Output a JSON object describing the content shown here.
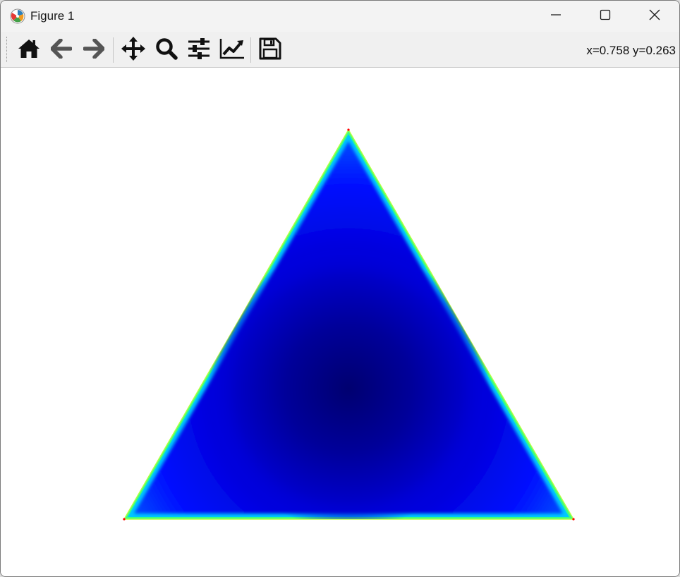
{
  "window": {
    "title": "Figure 1",
    "icon": "matplotlib-icon"
  },
  "titlebar_buttons": {
    "minimize": "minimize-icon",
    "maximize": "maximize-icon",
    "close": "close-icon"
  },
  "toolbar": {
    "buttons": [
      {
        "name": "home",
        "icon": "home-icon"
      },
      {
        "name": "back",
        "icon": "arrow-left-icon"
      },
      {
        "name": "forward",
        "icon": "arrow-right-icon"
      },
      {
        "name": "pan",
        "icon": "move-icon"
      },
      {
        "name": "zoom",
        "icon": "zoom-icon"
      },
      {
        "name": "subplots",
        "icon": "sliders-icon"
      },
      {
        "name": "customize",
        "icon": "chart-line-icon"
      },
      {
        "name": "save",
        "icon": "floppy-disk-icon"
      }
    ],
    "coords": "x=0.758 y=0.263"
  },
  "figure": {
    "shape": "equilateral triangle",
    "colormap": "jet",
    "colors": {
      "center": "#000080",
      "mid": "#0000cd",
      "body": "#0008ff",
      "edge_inner": "#00b4ff",
      "edge_outer": "#5aff60",
      "vertex": "#ff0000"
    }
  }
}
